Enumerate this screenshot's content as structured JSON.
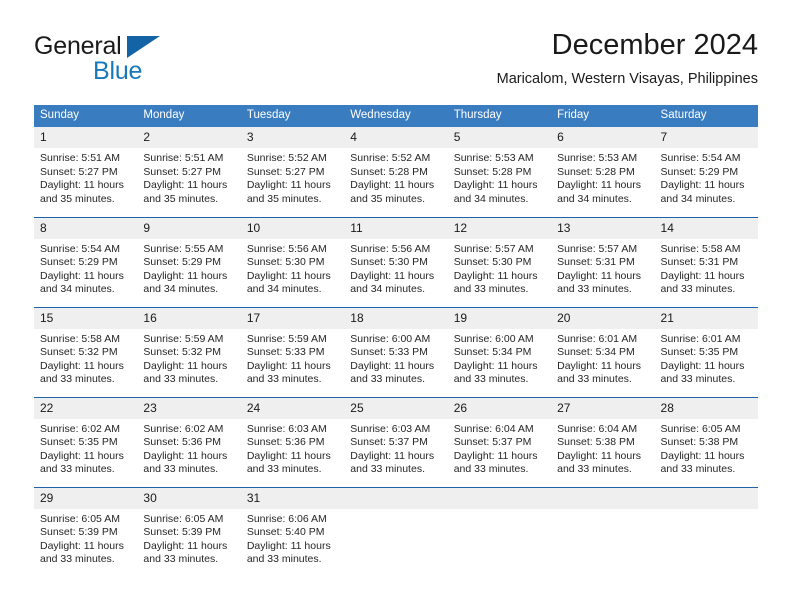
{
  "brand": {
    "name_part1": "General",
    "name_part2": "Blue",
    "logo_icon": "triangle-logo-icon",
    "accent_color": "#1779ba"
  },
  "header": {
    "title": "December 2024",
    "subtitle": "Maricalom, Western Visayas, Philippines"
  },
  "calendar": {
    "header_bg": "#3a7cc0",
    "separator_color": "#1f63a8",
    "daynum_bg": "#efefef",
    "weekdays": [
      "Sunday",
      "Monday",
      "Tuesday",
      "Wednesday",
      "Thursday",
      "Friday",
      "Saturday"
    ],
    "weeks": [
      [
        {
          "day": "1",
          "sunrise": "Sunrise: 5:51 AM",
          "sunset": "Sunset: 5:27 PM",
          "daylight": "Daylight: 11 hours and 35 minutes."
        },
        {
          "day": "2",
          "sunrise": "Sunrise: 5:51 AM",
          "sunset": "Sunset: 5:27 PM",
          "daylight": "Daylight: 11 hours and 35 minutes."
        },
        {
          "day": "3",
          "sunrise": "Sunrise: 5:52 AM",
          "sunset": "Sunset: 5:27 PM",
          "daylight": "Daylight: 11 hours and 35 minutes."
        },
        {
          "day": "4",
          "sunrise": "Sunrise: 5:52 AM",
          "sunset": "Sunset: 5:28 PM",
          "daylight": "Daylight: 11 hours and 35 minutes."
        },
        {
          "day": "5",
          "sunrise": "Sunrise: 5:53 AM",
          "sunset": "Sunset: 5:28 PM",
          "daylight": "Daylight: 11 hours and 34 minutes."
        },
        {
          "day": "6",
          "sunrise": "Sunrise: 5:53 AM",
          "sunset": "Sunset: 5:28 PM",
          "daylight": "Daylight: 11 hours and 34 minutes."
        },
        {
          "day": "7",
          "sunrise": "Sunrise: 5:54 AM",
          "sunset": "Sunset: 5:29 PM",
          "daylight": "Daylight: 11 hours and 34 minutes."
        }
      ],
      [
        {
          "day": "8",
          "sunrise": "Sunrise: 5:54 AM",
          "sunset": "Sunset: 5:29 PM",
          "daylight": "Daylight: 11 hours and 34 minutes."
        },
        {
          "day": "9",
          "sunrise": "Sunrise: 5:55 AM",
          "sunset": "Sunset: 5:29 PM",
          "daylight": "Daylight: 11 hours and 34 minutes."
        },
        {
          "day": "10",
          "sunrise": "Sunrise: 5:56 AM",
          "sunset": "Sunset: 5:30 PM",
          "daylight": "Daylight: 11 hours and 34 minutes."
        },
        {
          "day": "11",
          "sunrise": "Sunrise: 5:56 AM",
          "sunset": "Sunset: 5:30 PM",
          "daylight": "Daylight: 11 hours and 34 minutes."
        },
        {
          "day": "12",
          "sunrise": "Sunrise: 5:57 AM",
          "sunset": "Sunset: 5:30 PM",
          "daylight": "Daylight: 11 hours and 33 minutes."
        },
        {
          "day": "13",
          "sunrise": "Sunrise: 5:57 AM",
          "sunset": "Sunset: 5:31 PM",
          "daylight": "Daylight: 11 hours and 33 minutes."
        },
        {
          "day": "14",
          "sunrise": "Sunrise: 5:58 AM",
          "sunset": "Sunset: 5:31 PM",
          "daylight": "Daylight: 11 hours and 33 minutes."
        }
      ],
      [
        {
          "day": "15",
          "sunrise": "Sunrise: 5:58 AM",
          "sunset": "Sunset: 5:32 PM",
          "daylight": "Daylight: 11 hours and 33 minutes."
        },
        {
          "day": "16",
          "sunrise": "Sunrise: 5:59 AM",
          "sunset": "Sunset: 5:32 PM",
          "daylight": "Daylight: 11 hours and 33 minutes."
        },
        {
          "day": "17",
          "sunrise": "Sunrise: 5:59 AM",
          "sunset": "Sunset: 5:33 PM",
          "daylight": "Daylight: 11 hours and 33 minutes."
        },
        {
          "day": "18",
          "sunrise": "Sunrise: 6:00 AM",
          "sunset": "Sunset: 5:33 PM",
          "daylight": "Daylight: 11 hours and 33 minutes."
        },
        {
          "day": "19",
          "sunrise": "Sunrise: 6:00 AM",
          "sunset": "Sunset: 5:34 PM",
          "daylight": "Daylight: 11 hours and 33 minutes."
        },
        {
          "day": "20",
          "sunrise": "Sunrise: 6:01 AM",
          "sunset": "Sunset: 5:34 PM",
          "daylight": "Daylight: 11 hours and 33 minutes."
        },
        {
          "day": "21",
          "sunrise": "Sunrise: 6:01 AM",
          "sunset": "Sunset: 5:35 PM",
          "daylight": "Daylight: 11 hours and 33 minutes."
        }
      ],
      [
        {
          "day": "22",
          "sunrise": "Sunrise: 6:02 AM",
          "sunset": "Sunset: 5:35 PM",
          "daylight": "Daylight: 11 hours and 33 minutes."
        },
        {
          "day": "23",
          "sunrise": "Sunrise: 6:02 AM",
          "sunset": "Sunset: 5:36 PM",
          "daylight": "Daylight: 11 hours and 33 minutes."
        },
        {
          "day": "24",
          "sunrise": "Sunrise: 6:03 AM",
          "sunset": "Sunset: 5:36 PM",
          "daylight": "Daylight: 11 hours and 33 minutes."
        },
        {
          "day": "25",
          "sunrise": "Sunrise: 6:03 AM",
          "sunset": "Sunset: 5:37 PM",
          "daylight": "Daylight: 11 hours and 33 minutes."
        },
        {
          "day": "26",
          "sunrise": "Sunrise: 6:04 AM",
          "sunset": "Sunset: 5:37 PM",
          "daylight": "Daylight: 11 hours and 33 minutes."
        },
        {
          "day": "27",
          "sunrise": "Sunrise: 6:04 AM",
          "sunset": "Sunset: 5:38 PM",
          "daylight": "Daylight: 11 hours and 33 minutes."
        },
        {
          "day": "28",
          "sunrise": "Sunrise: 6:05 AM",
          "sunset": "Sunset: 5:38 PM",
          "daylight": "Daylight: 11 hours and 33 minutes."
        }
      ],
      [
        {
          "day": "29",
          "sunrise": "Sunrise: 6:05 AM",
          "sunset": "Sunset: 5:39 PM",
          "daylight": "Daylight: 11 hours and 33 minutes."
        },
        {
          "day": "30",
          "sunrise": "Sunrise: 6:05 AM",
          "sunset": "Sunset: 5:39 PM",
          "daylight": "Daylight: 11 hours and 33 minutes."
        },
        {
          "day": "31",
          "sunrise": "Sunrise: 6:06 AM",
          "sunset": "Sunset: 5:40 PM",
          "daylight": "Daylight: 11 hours and 33 minutes."
        },
        {
          "day": "",
          "sunrise": "",
          "sunset": "",
          "daylight": ""
        },
        {
          "day": "",
          "sunrise": "",
          "sunset": "",
          "daylight": ""
        },
        {
          "day": "",
          "sunrise": "",
          "sunset": "",
          "daylight": ""
        },
        {
          "day": "",
          "sunrise": "",
          "sunset": "",
          "daylight": ""
        }
      ]
    ]
  }
}
